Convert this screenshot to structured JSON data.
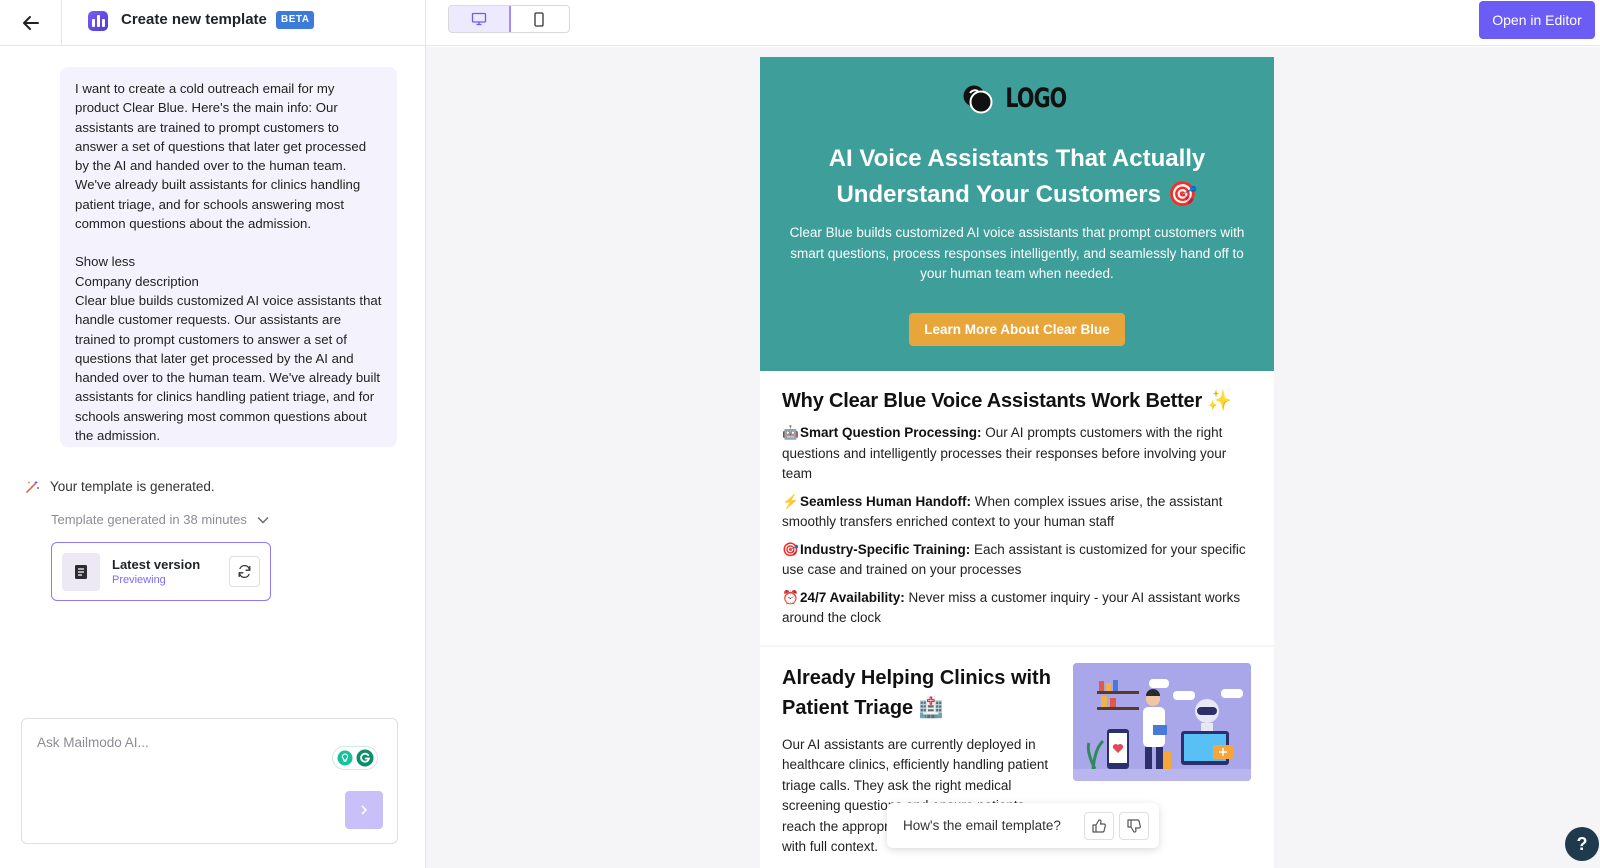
{
  "header": {
    "title": "Create new template",
    "badge": "BETA",
    "open_editor_label": "Open in Editor"
  },
  "chat": {
    "prompt_lines": [
      "I want to create a cold outreach email for my product Clear Blue. Here's the main info: Our assistants are trained to prompt customers to answer a set of questions that later get processed by the AI and handed over to the human team. We've already built assistants for clinics handling patient triage, and for schools answering most common questions about the admission.",
      "Show less",
      "Company description",
      "Clear blue builds customized AI voice assistants that handle customer requests. Our assistants are trained to prompt customers to answer a set of questions that later get processed by the AI and handed over to the human team. We've already built assistants for clinics handling patient triage, and for schools answering most common questions about the admission."
    ],
    "status": "Your template is generated.",
    "generation_meta": "Template generated in 38 minutes",
    "version_title": "Latest version",
    "version_status": "Previewing",
    "ask_placeholder": "Ask Mailmodo AI..."
  },
  "email": {
    "logo_text": "LOGO",
    "hero_title": "AI Voice Assistants That Actually Understand Your Customers 🎯",
    "hero_description": "Clear Blue builds customized AI voice assistants that prompt customers with smart questions, process responses intelligently, and seamlessly hand off to your human team when needed.",
    "cta_label": "Learn More About Clear Blue",
    "why_title": "Why Clear Blue Voice Assistants Work Better ✨",
    "features": [
      {
        "icon": "🤖",
        "title": "Smart Question Processing:",
        "text": " Our AI prompts customers with the right questions and intelligently processes their responses before involving your team"
      },
      {
        "icon": "⚡",
        "title": "Seamless Human Handoff:",
        "text": " When complex issues arise, the assistant smoothly transfers enriched context to your human staff"
      },
      {
        "icon": "🎯",
        "title": "Industry-Specific Training:",
        "text": " Each assistant is customized for your specific use case and trained on your processes"
      },
      {
        "icon": "⏰",
        "title": "24/7 Availability:",
        "text": " Never miss a customer inquiry - your AI assistant works around the clock"
      }
    ],
    "clinic_title": "Already Helping Clinics with Patient Triage 🏥",
    "clinic_text": "Our AI assistants are currently deployed in healthcare clinics, efficiently handling patient triage calls. They ask the right medical screening questions and ensure patients reach the appropriate care team member with full context."
  },
  "feedback": {
    "question": "How's the email template?"
  },
  "help": {
    "label": "?"
  },
  "colors": {
    "accent": "#6b5cf6",
    "hero_bg": "#3d9e9a",
    "cta_bg": "#e8a53a",
    "chat_bg": "#f4f2fc"
  }
}
